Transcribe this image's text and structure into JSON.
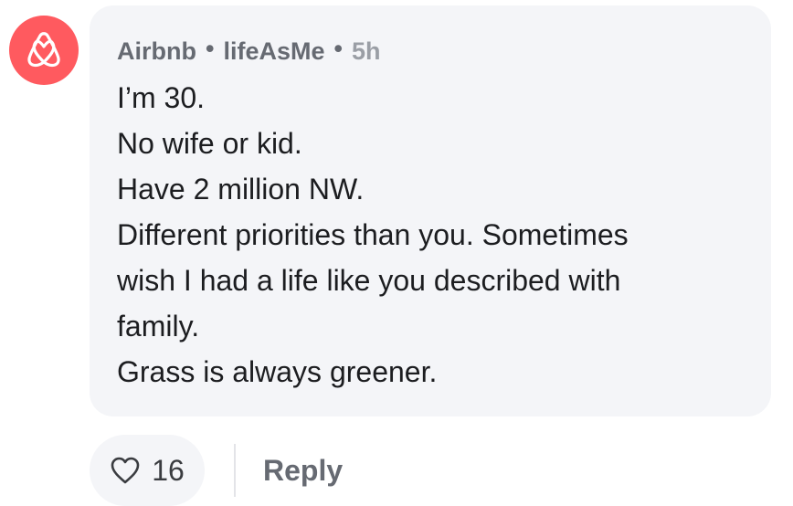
{
  "comment": {
    "brand": "Airbnb",
    "author": "lifeAsMe",
    "time": "5h",
    "separator": "•",
    "lines": [
      "I’m 30.",
      "No wife or kid.",
      "Have 2 million NW.",
      "Different priorities than you. Sometimes",
      "wish I had a life like you described with",
      "family.",
      "Grass is always greener."
    ]
  },
  "actions": {
    "like_count": "16",
    "reply_label": "Reply"
  },
  "icons": {
    "avatar": "airbnb-logo-icon",
    "like": "heart-icon"
  },
  "colors": {
    "avatar_bg": "#FF5A5F",
    "bubble_bg": "#F4F5F8"
  }
}
